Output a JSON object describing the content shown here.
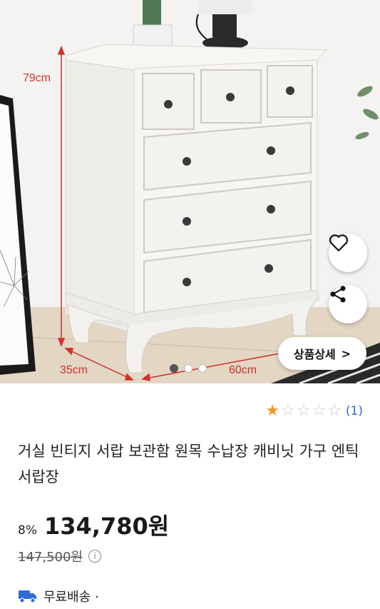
{
  "product_image": {
    "height_label": "79cm",
    "depth_label": "35cm",
    "width_label": "60cm",
    "carousel": {
      "total": 3,
      "active_index": 0
    },
    "detail_button_label": "상품상세",
    "detail_chevron": ">",
    "wishlist_icon": "heart-icon",
    "share_icon": "share-icon"
  },
  "rating": {
    "stars_filled": 1,
    "stars_total": 5,
    "count_text": "(1)",
    "colors": {
      "filled": "#f29a1f",
      "empty": "#c9c9c9",
      "count": "#2e6bd6"
    }
  },
  "product": {
    "title": "거실 빈티지 서랍 보관함 원목 수납장 캐비닛 가구 엔틱 서랍장",
    "discount": "8%",
    "price": "134,780원",
    "original_price": "147,500원",
    "info_icon": "info-icon",
    "info_glyph": "i"
  },
  "shipping": {
    "icon": "truck-icon",
    "label": "무료배송 ·",
    "icon_color": "#2e6bd6"
  }
}
